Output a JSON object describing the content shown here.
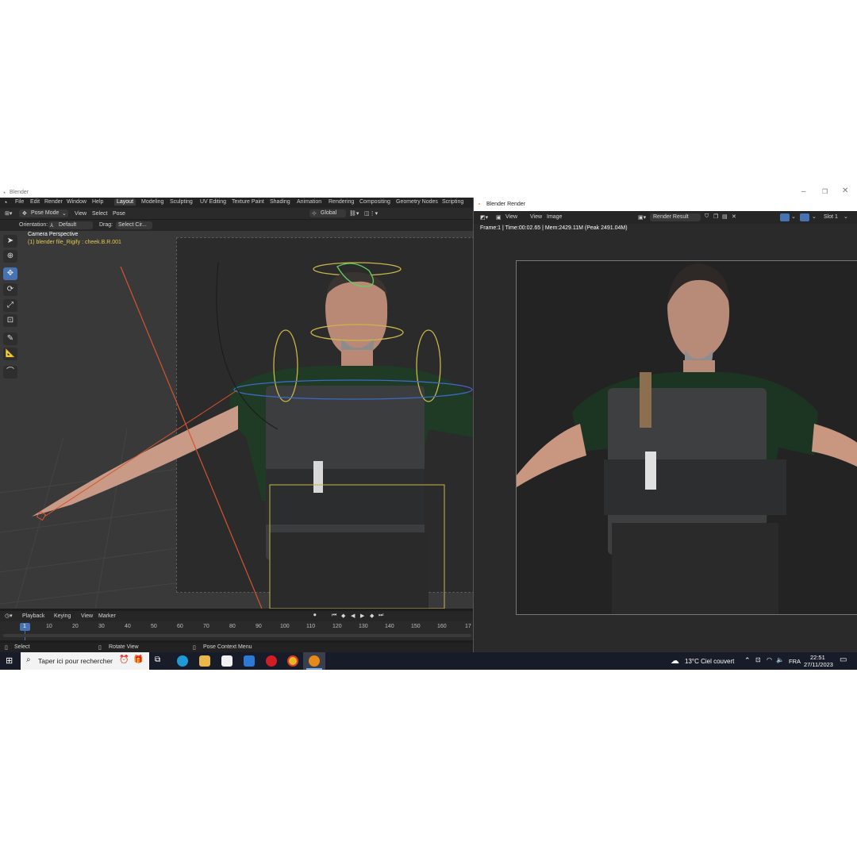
{
  "main_window": {
    "title": "Blender",
    "menu": [
      "File",
      "Edit",
      "Render",
      "Window",
      "Help"
    ],
    "workspaces": [
      "Layout",
      "Modeling",
      "Sculpting",
      "UV Editing",
      "Texture Paint",
      "Shading",
      "Animation",
      "Rendering",
      "Compositing",
      "Geometry Nodes",
      "Scripting"
    ],
    "active_workspace": "Layout"
  },
  "viewport_header": {
    "mode": "Pose Mode",
    "menus": [
      "View",
      "Select",
      "Pose"
    ],
    "transform_orientation": "Global"
  },
  "tool_settings": {
    "orientation_label": "Orientation:",
    "orientation_value": "Default",
    "drag_label": "Drag:",
    "drag_value": "Select Cir..."
  },
  "viewport": {
    "camera_label": "Camera Perspective",
    "active_object": "(1) blender file_Rigify : cheek.B.R.001",
    "tools": [
      "select-tool",
      "cursor-tool",
      "move-tool",
      "rotate-tool",
      "scale-tool",
      "transform-tool",
      "annotate-tool",
      "measure-tool",
      "relax-tool"
    ],
    "active_tool": "move-tool"
  },
  "timeline": {
    "menus": [
      "Playback",
      "Keying",
      "View",
      "Marker"
    ],
    "current_frame": "1",
    "ticks": [
      "10",
      "20",
      "30",
      "40",
      "50",
      "60",
      "70",
      "80",
      "90",
      "100",
      "110",
      "120",
      "130",
      "140",
      "150",
      "160",
      "17"
    ]
  },
  "status_bar": {
    "items": [
      "Select",
      "Rotate View",
      "Pose Context Menu"
    ]
  },
  "render_window": {
    "title": "Blender Render",
    "menus": [
      "View",
      "View",
      "Image"
    ],
    "image_name": "Render Result",
    "slot": "Slot 1",
    "info": "Frame:1 | Time:00:02.65 | Mem:2429.11M (Peak 2491.04M)"
  },
  "taskbar": {
    "search_placeholder": "Taper ici pour rechercher",
    "weather": "13°C  Ciel couvert",
    "language": "FRA",
    "time": "22:51",
    "date": "27/11/2023"
  }
}
